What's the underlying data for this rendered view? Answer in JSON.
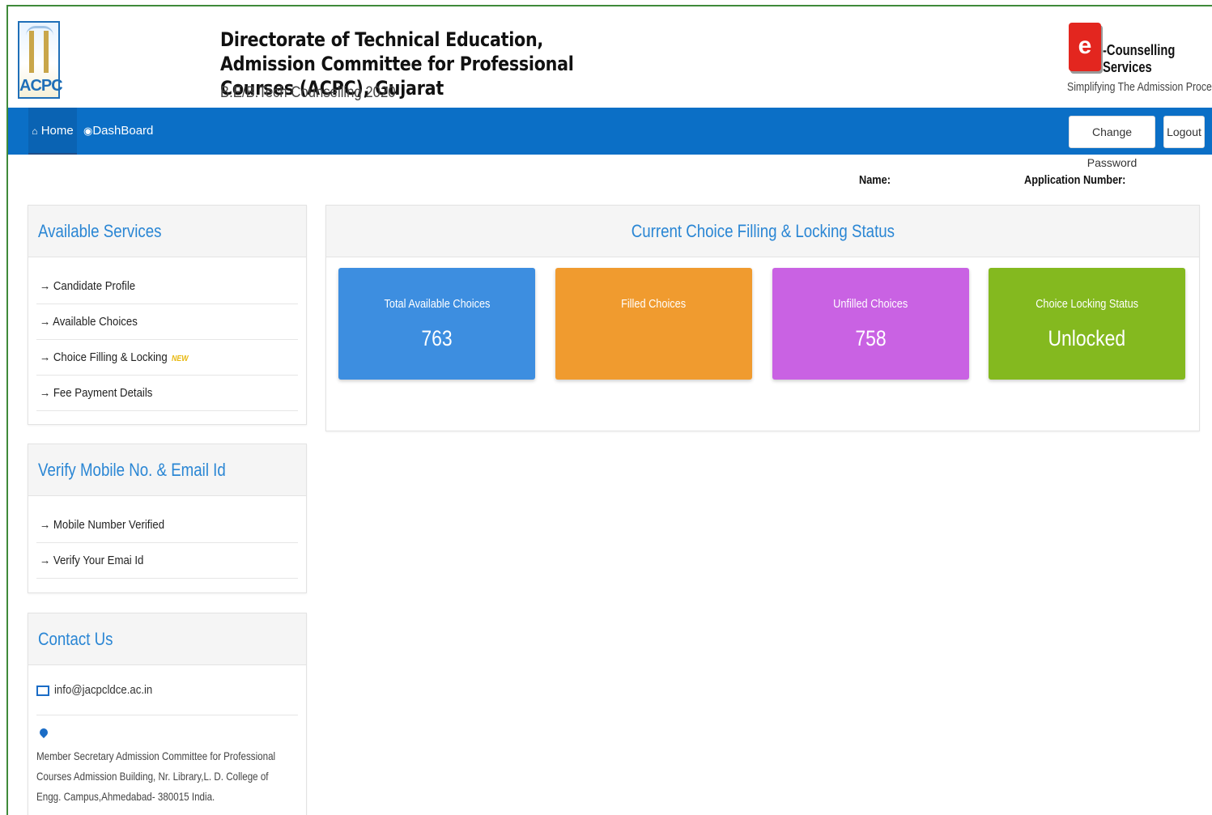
{
  "header": {
    "logo_text": "ACPC",
    "title": "Directorate of Technical Education, Admission Committee for Professional Courses (ACPC), Gujarat",
    "subtitle": "B.E/B.Tech Counselling 2020",
    "ecs_logo_letter": "e",
    "ecs_title": "-Counselling Services",
    "ecs_tagline": "Simplifying The Admission Process"
  },
  "nav": {
    "home": "Home",
    "dashboard": "DashBoard",
    "change_password": "Change Password",
    "logout": "Logout",
    "home_icon": "home-icon",
    "dashboard_icon": "dashboard-icon"
  },
  "info": {
    "name_label": "Name:",
    "application_label": "Application Number:"
  },
  "services": {
    "title": "Available Services",
    "items": [
      {
        "label": "Candidate Profile"
      },
      {
        "label": "Available Choices"
      },
      {
        "label": "Choice Filling & Locking",
        "badge": "NEW"
      },
      {
        "label": "Fee Payment Details"
      }
    ]
  },
  "verify": {
    "title": "Verify Mobile No. & Email Id",
    "items": [
      {
        "label": "Mobile Number Verified"
      },
      {
        "label": "Verify Your Emai Id"
      }
    ]
  },
  "contact": {
    "title": "Contact Us",
    "email": "info@jacpcldce.ac.in",
    "address": "Member Secretary Admission Committee for Professional Courses Admission Building, Nr. Library,L. D. College of Engg. Campus,Ahmedabad- 380015 India."
  },
  "status": {
    "title": "Current Choice Filling & Locking Status",
    "cards": [
      {
        "label": "Total Available Choices",
        "value": "763",
        "color": "#3d8ee0"
      },
      {
        "label": "Filled Choices",
        "value": "",
        "color": "#f09b2f"
      },
      {
        "label": "Unfilled Choices",
        "value": "758",
        "color": "#c962e3"
      },
      {
        "label": "Choice Locking Status",
        "value": "Unlocked",
        "color": "#84b91f"
      }
    ]
  },
  "colors": {
    "nav_bg": "#0b6fc6",
    "accent": "#2a86d4",
    "frame": "#3f8a3a"
  }
}
